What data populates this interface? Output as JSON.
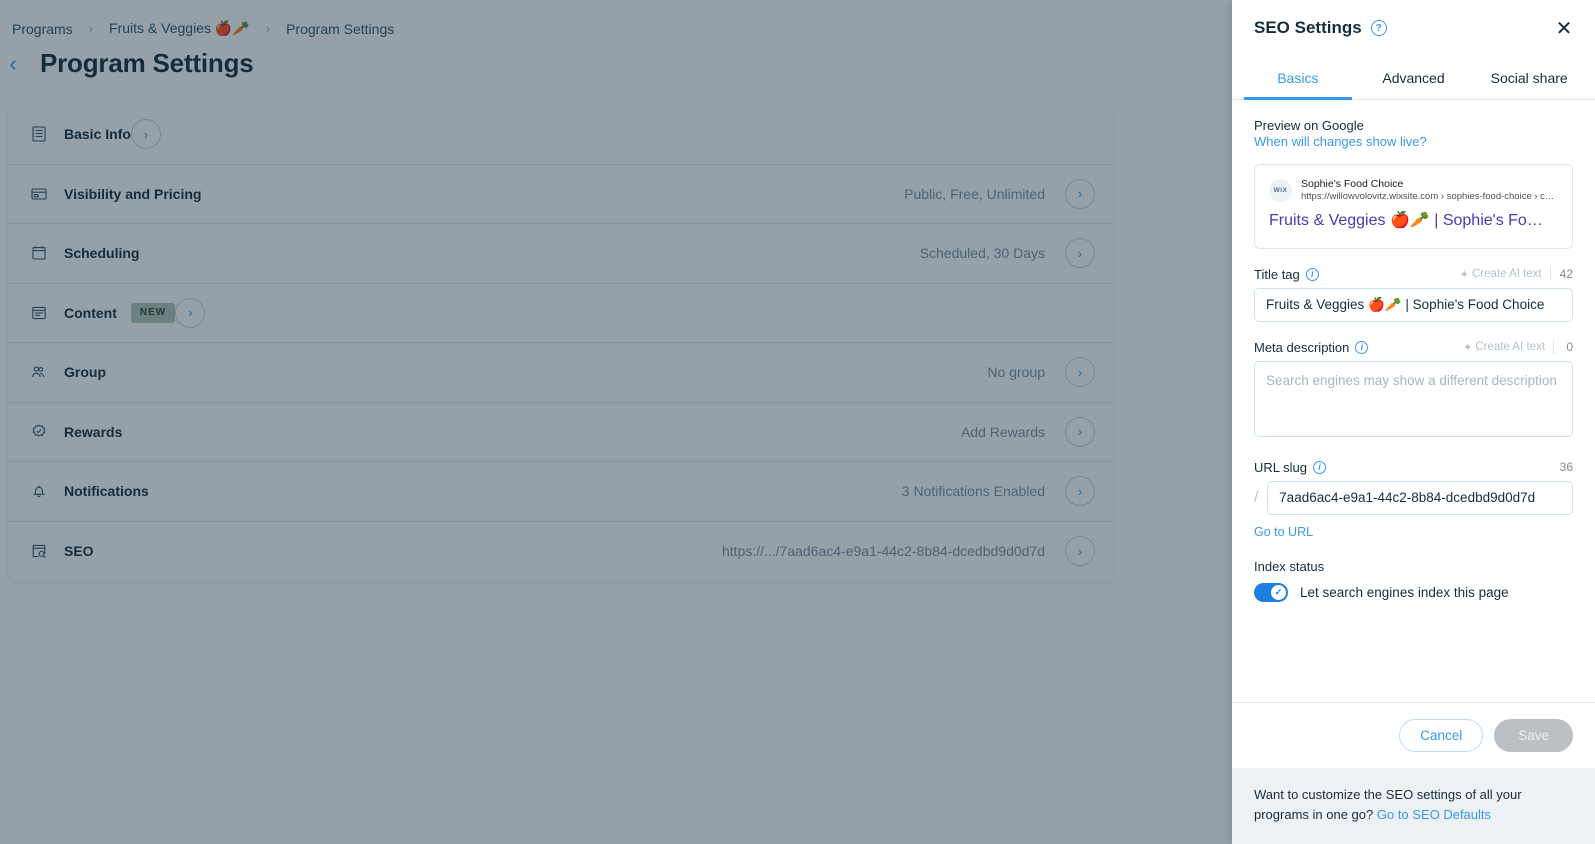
{
  "breadcrumb": {
    "items": [
      "Programs",
      "Fruits & Veggies 🍎🥕",
      "Program Settings"
    ],
    "separator": "›"
  },
  "page": {
    "title": "Program Settings",
    "back_icon": "chevron-left-icon"
  },
  "settings_rows": [
    {
      "icon": "list-document-icon",
      "label": "Basic Info",
      "value": "",
      "badge": ""
    },
    {
      "icon": "card-icon",
      "label": "Visibility and Pricing",
      "value": "Public, Free, Unlimited",
      "badge": ""
    },
    {
      "icon": "calendar-icon",
      "label": "Scheduling",
      "value": "Scheduled, 30 Days",
      "badge": ""
    },
    {
      "icon": "content-window-icon",
      "label": "Content",
      "value": "",
      "badge": "NEW"
    },
    {
      "icon": "group-people-icon",
      "label": "Group",
      "value": "No group",
      "badge": ""
    },
    {
      "icon": "badge-check-icon",
      "label": "Rewards",
      "value": "Add Rewards",
      "badge": ""
    },
    {
      "icon": "bell-icon",
      "label": "Notifications",
      "value": "3 Notifications Enabled",
      "badge": ""
    },
    {
      "icon": "seo-search-page-icon",
      "label": "SEO",
      "value": "https://.../7aad6ac4-e9a1-44c2-8b84-dcedbd9d0d7d",
      "badge": ""
    }
  ],
  "panel": {
    "title": "SEO Settings",
    "help_icon": "?",
    "close_icon": "✕",
    "tabs": [
      {
        "label": "Basics",
        "active": true
      },
      {
        "label": "Advanced",
        "active": false
      },
      {
        "label": "Social share",
        "active": false
      }
    ],
    "preview": {
      "label": "Preview on Google",
      "link": "When will changes show live?",
      "avatar_text": "WIX",
      "site_name": "Sophie's Food Choice",
      "url": "https://willowvolovitz.wixsite.com › sophies-food-choice › challenge-p…",
      "title": "Fruits & Veggies 🍎🥕 | Sophie's Fo…"
    },
    "title_tag": {
      "label": "Title tag",
      "ai_label": "Create AI text",
      "count": "42",
      "value": "Fruits & Veggies 🍎🥕 | Sophie's Food Choice"
    },
    "meta_description": {
      "label": "Meta description",
      "ai_label": "Create AI text",
      "count": "0",
      "value": "",
      "placeholder": "Search engines may show a different description"
    },
    "url_slug": {
      "label": "URL slug",
      "count": "36",
      "prefix": "/",
      "value": "7aad6ac4-e9a1-44c2-8b84-dcedbd9d0d7d",
      "go_to_url": "Go to URL"
    },
    "index_status": {
      "label": "Index status",
      "toggle_label": "Let search engines index this page",
      "enabled": true
    },
    "actions": {
      "cancel": "Cancel",
      "save": "Save"
    },
    "footer": {
      "text": "Want to customize the SEO settings of all your programs in one go? ",
      "link": "Go to SEO Defaults"
    }
  },
  "colors": {
    "accent": "#3899ec",
    "title": "#162d3d",
    "muted": "#7a92a5",
    "toggle_on": "#1d7fe0",
    "badge_new_bg": "#aec6b4",
    "google_title": "#4f37b5"
  }
}
